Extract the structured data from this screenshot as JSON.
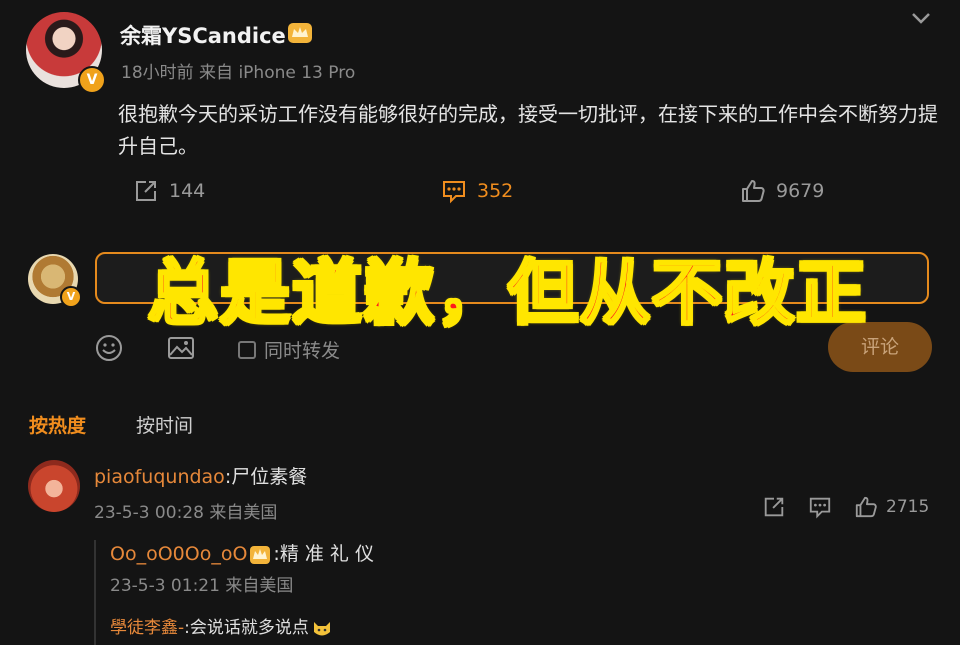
{
  "post": {
    "username": "余霜YSCandice",
    "meta": "18小时前 来自 iPhone 13 Pro",
    "text": "很抱歉今天的采访工作没有能够很好的完成，接受一切批评，在接下来的工作中会不断努力提升自己。",
    "repost_count": "144",
    "comment_count": "352",
    "like_count": "9679",
    "verified_badge": "V"
  },
  "composer": {
    "submit_label": "评论",
    "repost_label": "同时转发"
  },
  "overlay_text": "总是道歉，但从不改正",
  "sort": {
    "hot": "按热度",
    "time": "按时间"
  },
  "comments": [
    {
      "user": "piaofuqundao",
      "text": ":尸位素餐",
      "meta": "23-5-3 00:28 来自美国",
      "like_count": "2715",
      "replies": [
        {
          "user": "Oo_oO0Oo_oO",
          "text": ":精 准 礼 仪",
          "meta": "23-5-3 01:21 来自美国"
        },
        {
          "user": "學徒李鑫-",
          "text": ":会说话就多说点"
        }
      ]
    }
  ],
  "colors": {
    "accent": "#f08d1e",
    "background": "#141414",
    "overlay_red": "#ff1a1a",
    "overlay_yellow": "#ffe600"
  },
  "icons": [
    "chevron-down-icon",
    "repost-icon",
    "comment-icon",
    "like-icon",
    "emoji-icon",
    "image-icon",
    "crown-icon",
    "cat-emoji-icon"
  ]
}
